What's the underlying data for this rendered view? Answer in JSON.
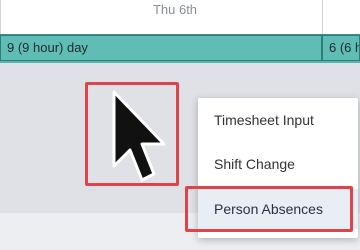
{
  "calendar": {
    "day_header": "Thu 6th",
    "shift_cells": [
      {
        "label": "9 (9 hour) day"
      },
      {
        "label": "6 (6 ho"
      }
    ]
  },
  "context_menu": {
    "items": [
      {
        "label": "Timesheet Input"
      },
      {
        "label": "Shift Change"
      },
      {
        "label": "Person Absences",
        "state": "hovered"
      }
    ]
  },
  "annotation": {
    "highlight_color": "#e0434a",
    "cursor_icon": "arrow-cursor-icon"
  },
  "colors": {
    "shift_band": "#5fbdb6",
    "shift_border": "#2f7e78",
    "menu_hover": "#e9edf4"
  }
}
